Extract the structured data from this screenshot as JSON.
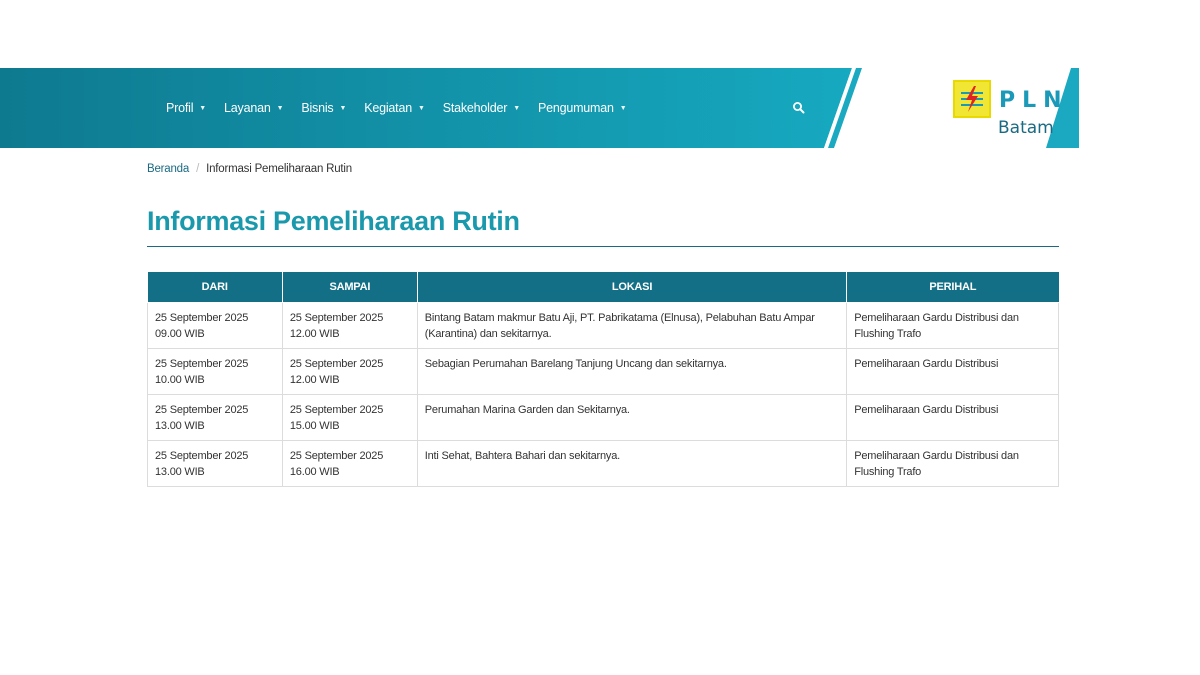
{
  "nav": {
    "items": [
      {
        "label": "Profil"
      },
      {
        "label": "Layanan"
      },
      {
        "label": "Bisnis"
      },
      {
        "label": "Kegiatan"
      },
      {
        "label": "Stakeholder"
      },
      {
        "label": "Pengumuman"
      }
    ],
    "caret": "▼"
  },
  "logo": {
    "brand": "PLN",
    "region": "Batam"
  },
  "breadcrumb": {
    "home": "Beranda",
    "separator": "/",
    "current": "Informasi Pemeliharaan Rutin"
  },
  "page_title": "Informasi Pemeliharaan Rutin",
  "table": {
    "headers": [
      "DARI",
      "SAMPAI",
      "LOKASI",
      "PERIHAL"
    ],
    "rows": [
      [
        "25 September 2025 09.00 WIB",
        "25 September 2025 12.00 WIB",
        "Bintang Batam makmur Batu Aji, PT. Pabrikatama (Elnusa), Pelabuhan Batu Ampar (Karantina) dan sekitarnya.",
        "Pemeliharaan Gardu Distribusi dan Flushing Trafo"
      ],
      [
        "25 September 2025 10.00 WIB",
        "25 September 2025 12.00 WIB",
        "Sebagian Perumahan Barelang Tanjung Uncang dan sekitarnya.",
        "Pemeliharaan Gardu Distribusi"
      ],
      [
        "25 September 2025 13.00 WIB",
        "25 September 2025 15.00 WIB",
        "Perumahan Marina Garden dan Sekitarnya.",
        "Pemeliharaan Gardu Distribusi"
      ],
      [
        "25 September 2025 13.00 WIB",
        "25 September 2025 16.00 WIB",
        "Inti Sehat, Bahtera Bahari dan sekitarnya.",
        "Pemeliharaan Gardu Distribusi dan Flushing Trafo"
      ]
    ]
  },
  "colors": {
    "header_dark": "#0f7f96",
    "header_light": "#15a7bd",
    "title": "#1b99ac",
    "table_header": "#136f86",
    "logo_yellow": "#f2e634"
  }
}
